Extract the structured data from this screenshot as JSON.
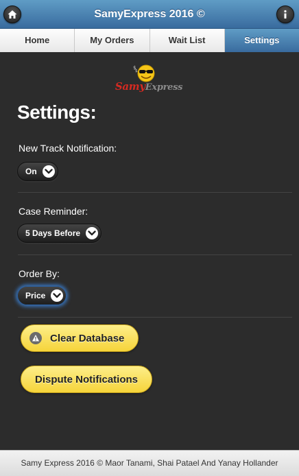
{
  "header": {
    "title": "SamyExpress 2016 ©",
    "home_icon": "home-icon",
    "info_icon": "info-icon"
  },
  "nav": {
    "tabs": [
      {
        "label": "Home"
      },
      {
        "label": "My Orders"
      },
      {
        "label": "Wait List"
      },
      {
        "label": "Settings",
        "active": true
      }
    ]
  },
  "logo": {
    "samy": "Samy",
    "express": "Express"
  },
  "settings": {
    "heading": "Settings:",
    "track_notification": {
      "label": "New Track Notification:",
      "value": "On"
    },
    "case_reminder": {
      "label": "Case Reminder:",
      "value": "5 Days Before"
    },
    "order_by": {
      "label": "Order By:",
      "value": "Price"
    }
  },
  "actions": {
    "clear_database": "Clear Database",
    "dispute_notifications": "Dispute Notifications"
  },
  "footer": {
    "text": "Samy Express 2016 © Maor Tanami, Shai Patael And Yanay Hollander"
  },
  "colors": {
    "header_blue": "#4a86b8",
    "button_yellow": "#f9e05a",
    "logo_red": "#d62a21",
    "background": "#2c2c2c"
  }
}
